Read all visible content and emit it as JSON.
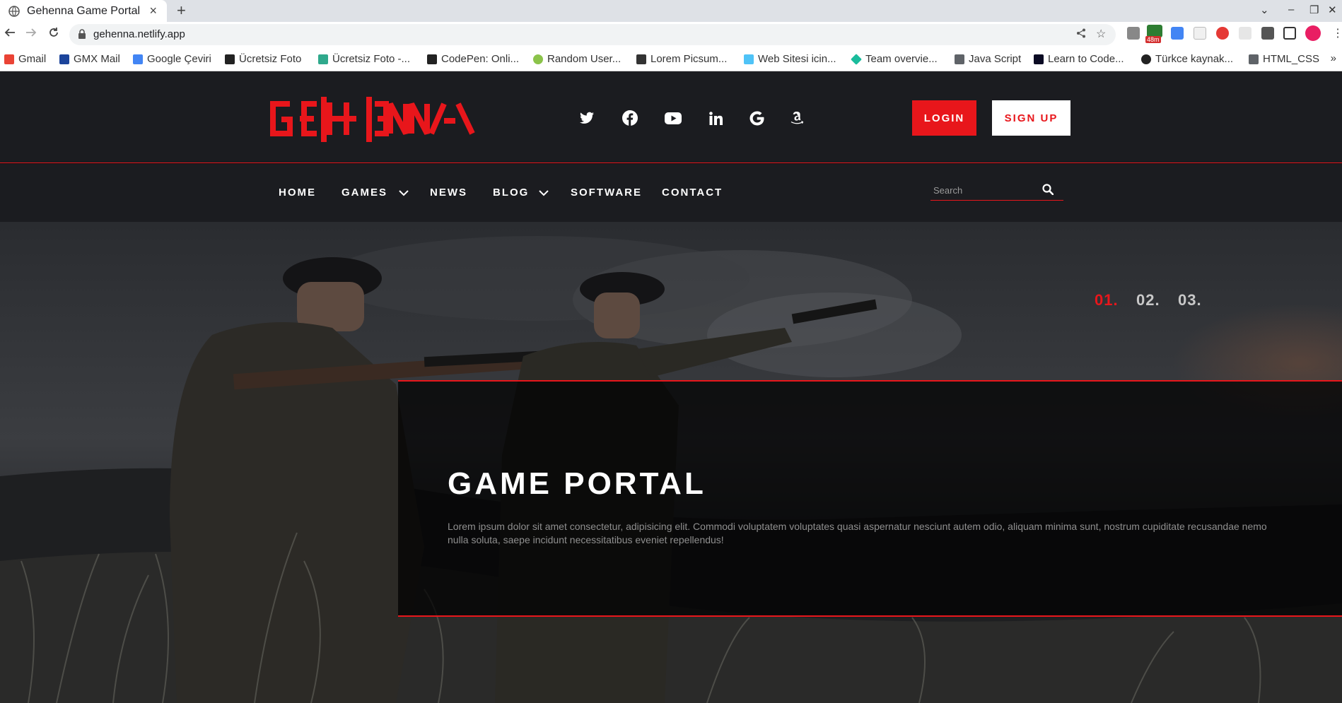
{
  "browser": {
    "tab_title": "Gehenna Game Portal",
    "url": "gehenna.netlify.app",
    "bookmarks": [
      {
        "label": "Gmail",
        "color": "#ea4335"
      },
      {
        "label": "GMX Mail",
        "color": "#1c449b"
      },
      {
        "label": "Google Çeviri",
        "color": "#4285f4"
      },
      {
        "label": "Ücretsiz Foto",
        "color": "#222222"
      },
      {
        "label": "Ücretsiz Foto -...",
        "color": "#2fa98c"
      },
      {
        "label": "CodePen: Onli...",
        "color": "#222222"
      },
      {
        "label": "Random User...",
        "color": "#8bc34a"
      },
      {
        "label": "Lorem Picsum...",
        "color": "#333333"
      },
      {
        "label": "Web Sitesi icin...",
        "color": "#4fc3f7"
      },
      {
        "label": "Team overvie...",
        "color": "#1abc9c"
      },
      {
        "label": "Java Script",
        "color": "#5f6368"
      },
      {
        "label": "Learn to Code...",
        "color": "#0a0a23"
      },
      {
        "label": "Türkce kaynak...",
        "color": "#222222"
      },
      {
        "label": "HTML_CSS",
        "color": "#5f6368"
      }
    ],
    "more_label": "»",
    "ext_badge": "48m"
  },
  "site": {
    "logo_text": "GEHENNA",
    "social_icons": [
      "twitter-icon",
      "facebook-icon",
      "youtube-icon",
      "linkedin-icon",
      "google-icon",
      "amazon-icon"
    ],
    "login_label": "LOGIN",
    "signup_label": "SIGN UP",
    "menu": [
      {
        "label": "HOME",
        "dropdown": false
      },
      {
        "label": "GAMES",
        "dropdown": true
      },
      {
        "label": "NEWS",
        "dropdown": false
      },
      {
        "label": "BLOG",
        "dropdown": true
      },
      {
        "label": "SOFTWARE",
        "dropdown": false
      },
      {
        "label": "CONTACT",
        "dropdown": false
      }
    ],
    "search_placeholder": "Search",
    "slides": [
      {
        "label": "01.",
        "active": true
      },
      {
        "label": "02.",
        "active": false
      },
      {
        "label": "03.",
        "active": false
      }
    ],
    "hero_title": "GAME PORTAL",
    "hero_text": "Lorem ipsum dolor sit amet consectetur, adipisicing elit. Commodi voluptatem voluptates quasi aspernatur nesciunt autem odio, aliquam minima sunt, nostrum cupiditate recusandae nemo nulla soluta, saepe incidunt necessitatibus eveniet repellendus!",
    "colors": {
      "accent": "#e8161b",
      "header_bg": "#1b1c20",
      "inactive_slide": "#c8c8c8"
    }
  }
}
